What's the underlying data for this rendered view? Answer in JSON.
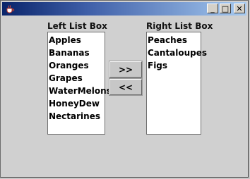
{
  "window": {
    "title": "",
    "controls": {
      "minimize": "_",
      "maximize": "□",
      "close": "✕"
    },
    "icon": "java-cup-icon",
    "titlebar_color": "#0a246a"
  },
  "left_list": {
    "label": "Left List Box",
    "items": [
      "Apples",
      "Bananas",
      "Oranges",
      "Grapes",
      "WaterMelons",
      "HoneyDew",
      "Nectarines"
    ]
  },
  "right_list": {
    "label": "Right List Box",
    "items": [
      "Peaches",
      "Cantaloupes",
      "Figs"
    ]
  },
  "buttons": {
    "move_right": ">>",
    "move_left": "<<"
  }
}
